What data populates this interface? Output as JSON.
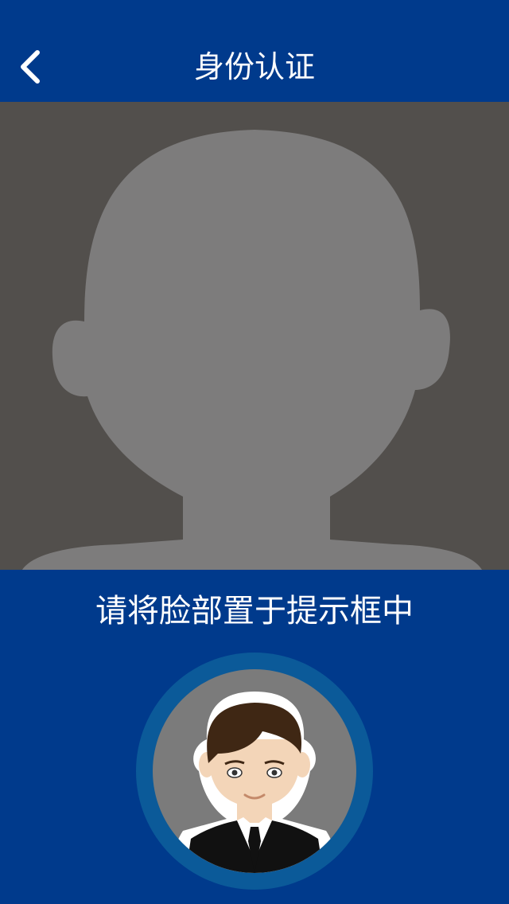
{
  "nav": {
    "title": "身份认证",
    "back_icon": "chevron-left-icon"
  },
  "camera": {
    "overlay_icon": "face-outline-icon"
  },
  "instruction": {
    "text": "请将脸部置于提示框中"
  },
  "sample": {
    "icon": "sample-face-avatar-icon"
  },
  "colors": {
    "primary": "#003a8c",
    "camera_bg": "#524f4c",
    "silhouette": "#7d7c7c",
    "ring": "#0b5a99",
    "text": "#ffffff"
  }
}
